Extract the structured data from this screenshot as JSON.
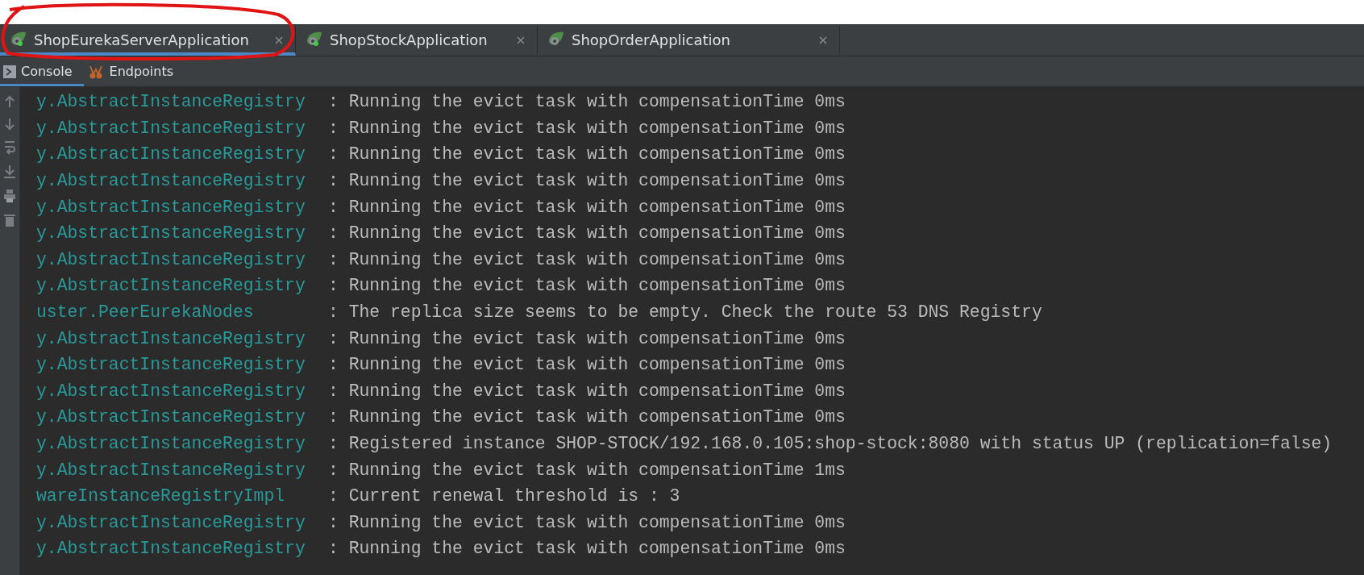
{
  "run_tabs": [
    {
      "label": "ShopEurekaServerApplication",
      "selected": true,
      "running": true
    },
    {
      "label": "ShopStockApplication",
      "selected": false,
      "running": true
    },
    {
      "label": "ShopOrderApplication",
      "selected": false,
      "running": false
    }
  ],
  "tool_tabs": [
    {
      "label": "Console",
      "kind": "console",
      "selected": true
    },
    {
      "label": "Endpoints",
      "kind": "endpoints",
      "selected": false
    }
  ],
  "log_lines": [
    {
      "logger": "y.AbstractInstanceRegistry",
      "message": ": Running the evict task with compensationTime 0ms"
    },
    {
      "logger": "y.AbstractInstanceRegistry",
      "message": ": Running the evict task with compensationTime 0ms"
    },
    {
      "logger": "y.AbstractInstanceRegistry",
      "message": ": Running the evict task with compensationTime 0ms"
    },
    {
      "logger": "y.AbstractInstanceRegistry",
      "message": ": Running the evict task with compensationTime 0ms"
    },
    {
      "logger": "y.AbstractInstanceRegistry",
      "message": ": Running the evict task with compensationTime 0ms"
    },
    {
      "logger": "y.AbstractInstanceRegistry",
      "message": ": Running the evict task with compensationTime 0ms"
    },
    {
      "logger": "y.AbstractInstanceRegistry",
      "message": ": Running the evict task with compensationTime 0ms"
    },
    {
      "logger": "y.AbstractInstanceRegistry",
      "message": ": Running the evict task with compensationTime 0ms"
    },
    {
      "logger": "uster.PeerEurekaNodes",
      "message": ": The replica size seems to be empty. Check the route 53 DNS Registry"
    },
    {
      "logger": "y.AbstractInstanceRegistry",
      "message": ": Running the evict task with compensationTime 0ms"
    },
    {
      "logger": "y.AbstractInstanceRegistry",
      "message": ": Running the evict task with compensationTime 0ms"
    },
    {
      "logger": "y.AbstractInstanceRegistry",
      "message": ": Running the evict task with compensationTime 0ms"
    },
    {
      "logger": "y.AbstractInstanceRegistry",
      "message": ": Running the evict task with compensationTime 0ms"
    },
    {
      "logger": "y.AbstractInstanceRegistry",
      "message": ": Registered instance SHOP-STOCK/192.168.0.105:shop-stock:8080 with status UP (replication=false)"
    },
    {
      "logger": "y.AbstractInstanceRegistry",
      "message": ": Running the evict task with compensationTime 1ms"
    },
    {
      "logger": "wareInstanceRegistryImpl",
      "message": ": Current renewal threshold is : 3"
    },
    {
      "logger": "y.AbstractInstanceRegistry",
      "message": ": Running the evict task with compensationTime 0ms"
    },
    {
      "logger": "y.AbstractInstanceRegistry",
      "message": ": Running the evict task with compensationTime 0ms"
    }
  ]
}
